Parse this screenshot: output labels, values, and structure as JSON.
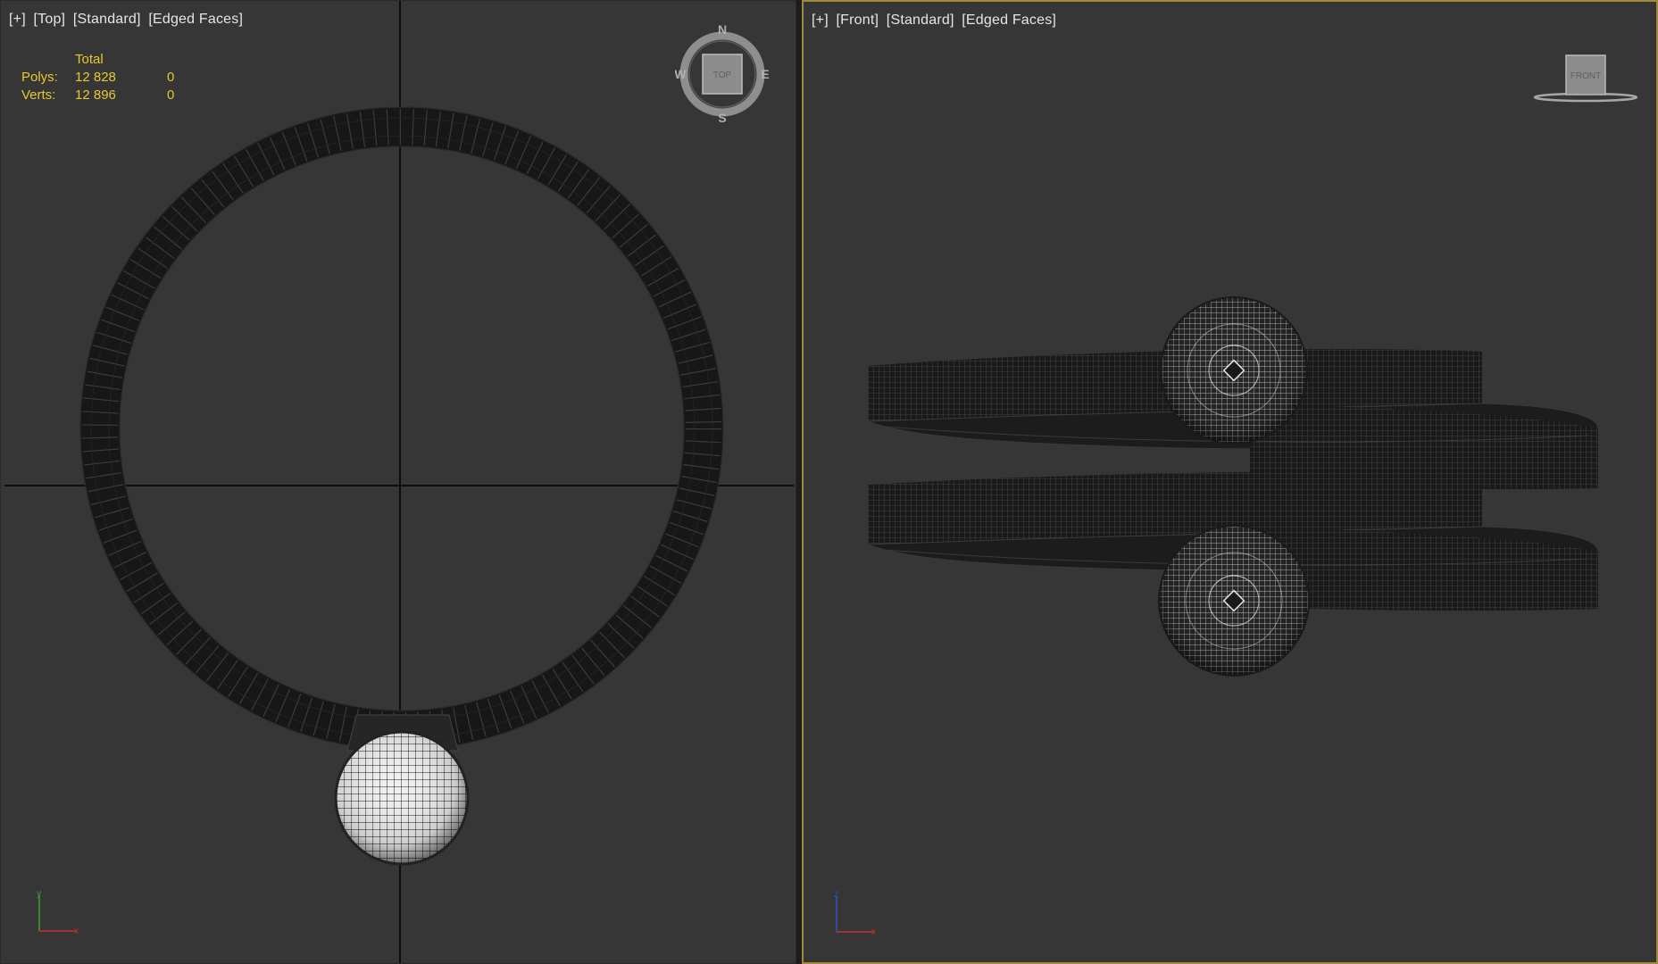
{
  "top_viewport": {
    "label_items": [
      "[+]",
      "[Top]",
      "[Standard]",
      "[Edged Faces]"
    ],
    "stats": {
      "header": "Total",
      "rows": [
        {
          "label": "Polys:",
          "total": "12 828",
          "selected": "0"
        },
        {
          "label": "Verts:",
          "total": "12 896",
          "selected": "0"
        }
      ]
    },
    "compass": {
      "cube_label": "TOP",
      "north": "N",
      "south": "S",
      "east": "E",
      "west": "W"
    },
    "axes": {
      "vertical": "y",
      "horizontal": "x"
    }
  },
  "front_viewport": {
    "label_items": [
      "[+]",
      "[Front]",
      "[Standard]",
      "[Edged Faces]"
    ],
    "view_cube_label": "FRONT",
    "axes": {
      "vertical": "z",
      "horizontal": "x"
    }
  },
  "colors": {
    "viewport_bg": "#363636",
    "active_border": "#a08a3a",
    "stats_text": "#e8c830",
    "label_text": "#e6e6e6",
    "mesh_dark": "#171717",
    "mesh_wire": "#4a4a4a"
  }
}
